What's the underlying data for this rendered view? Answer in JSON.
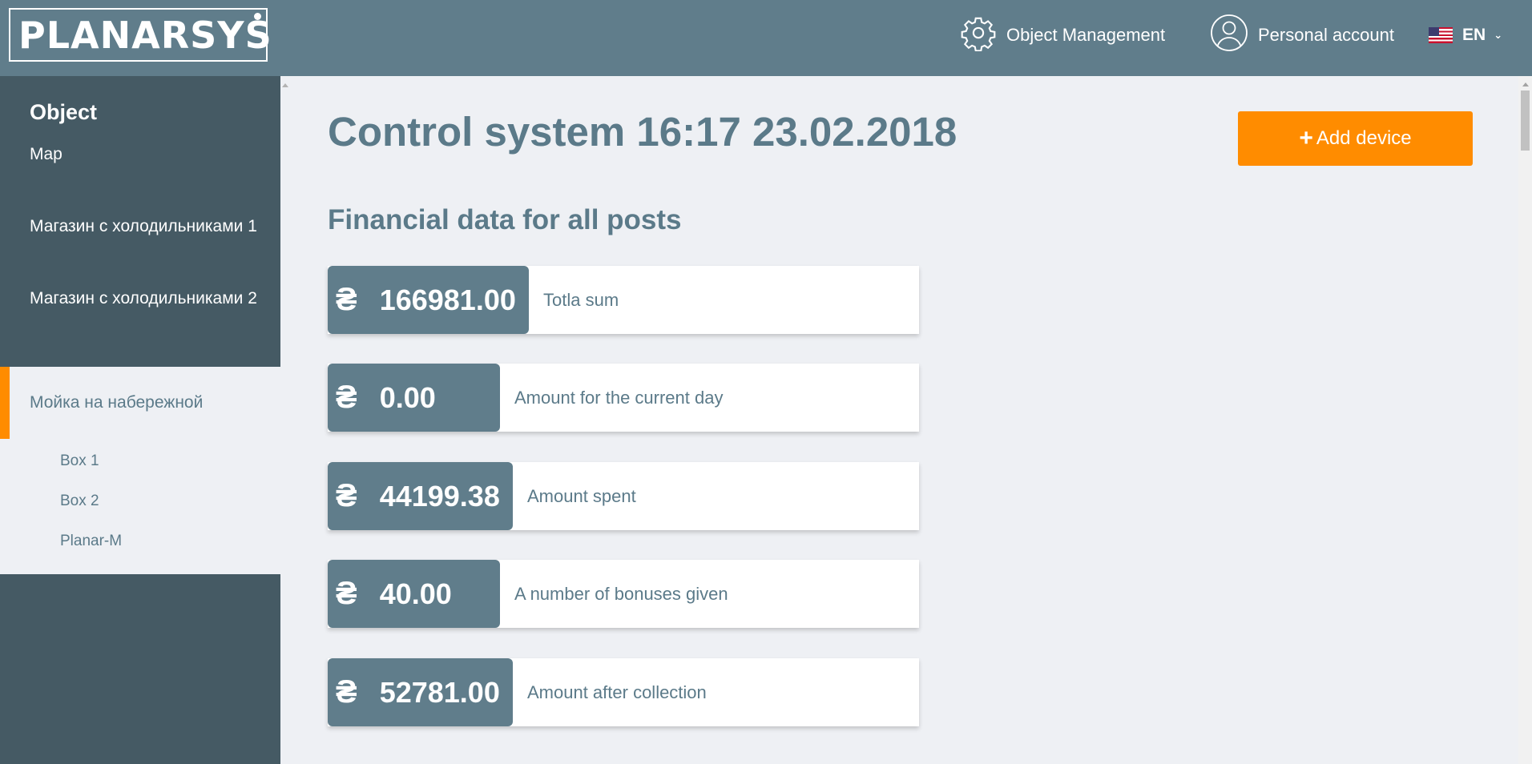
{
  "header": {
    "logo_text": "PLANARSYS",
    "object_management": "Object Management",
    "personal_account": "Personal account",
    "language": "EN",
    "icons": [
      "gear-icon",
      "user-icon",
      "us-flag-icon",
      "chevron-down-icon"
    ]
  },
  "sidebar": {
    "heading": "Object",
    "items": [
      {
        "label": "Map"
      },
      {
        "label": "Магазин с холодильниками 1"
      },
      {
        "label": "Магазин с холодильниками 2"
      },
      {
        "label": "Мойка на набережной",
        "active": true
      }
    ],
    "sub_items": [
      {
        "label": "Box 1"
      },
      {
        "label": "Box 2"
      },
      {
        "label": "Planar-M"
      }
    ]
  },
  "main": {
    "title": "Control system 16:17 23.02.2018",
    "add_button": "Add device",
    "subtitle": "Financial data for all posts",
    "currency_symbol": "₴",
    "cards": [
      {
        "value": "166981.00",
        "label": "Totla sum"
      },
      {
        "value": "0.00",
        "label": "Amount for the current day"
      },
      {
        "value": "44199.38",
        "label": "Amount spent"
      },
      {
        "value": "40.00",
        "label": "A number of bonuses given"
      },
      {
        "value": "52781.00",
        "label": "Amount after collection"
      }
    ]
  },
  "colors": {
    "header_bg": "#607d8b",
    "sidebar_bg": "#455a64",
    "content_bg": "#eef0f4",
    "accent": "#ff8c00",
    "text": "#5b7a89"
  }
}
